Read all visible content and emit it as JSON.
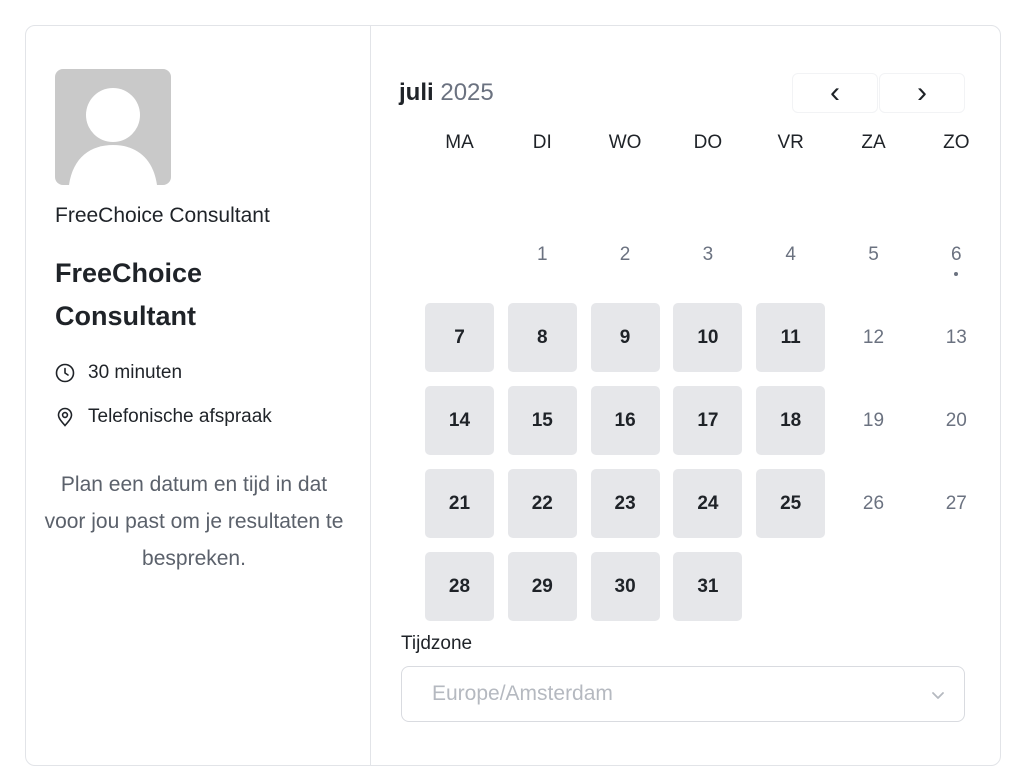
{
  "host": {
    "name": "FreeChoice Consultant",
    "avatar_icon": "user-silhouette-icon"
  },
  "event": {
    "title": "FreeChoice Consultant",
    "duration": "30 minuten",
    "duration_icon": "clock-icon",
    "location": "Telefonische afspraak",
    "location_icon": "location-pin-icon",
    "description": "Plan een datum en tijd in dat voor jou past om je resultaten te bespreken."
  },
  "calendar": {
    "month": "juli",
    "year": "2025",
    "prev_label": "‹",
    "next_label": "›",
    "weekdays": [
      "MA",
      "DI",
      "WO",
      "DO",
      "VR",
      "ZA",
      "ZO"
    ],
    "first_weekday_index": 1,
    "days": [
      {
        "day": "1",
        "available": false
      },
      {
        "day": "2",
        "available": false
      },
      {
        "day": "3",
        "available": false
      },
      {
        "day": "4",
        "available": false
      },
      {
        "day": "5",
        "available": false
      },
      {
        "day": "6",
        "available": false,
        "today": true
      },
      {
        "day": "7",
        "available": true
      },
      {
        "day": "8",
        "available": true
      },
      {
        "day": "9",
        "available": true
      },
      {
        "day": "10",
        "available": true
      },
      {
        "day": "11",
        "available": true
      },
      {
        "day": "12",
        "available": false
      },
      {
        "day": "13",
        "available": false
      },
      {
        "day": "14",
        "available": true
      },
      {
        "day": "15",
        "available": true
      },
      {
        "day": "16",
        "available": true
      },
      {
        "day": "17",
        "available": true
      },
      {
        "day": "18",
        "available": true
      },
      {
        "day": "19",
        "available": false
      },
      {
        "day": "20",
        "available": false
      },
      {
        "day": "21",
        "available": true
      },
      {
        "day": "22",
        "available": true
      },
      {
        "day": "23",
        "available": true
      },
      {
        "day": "24",
        "available": true
      },
      {
        "day": "25",
        "available": true
      },
      {
        "day": "26",
        "available": false
      },
      {
        "day": "27",
        "available": false
      },
      {
        "day": "28",
        "available": true
      },
      {
        "day": "29",
        "available": true
      },
      {
        "day": "30",
        "available": true
      },
      {
        "day": "31",
        "available": true
      }
    ]
  },
  "timezone": {
    "label": "Tijdzone",
    "value": "Europe/Amsterdam",
    "chevron_icon": "chevron-down-icon"
  },
  "colors": {
    "available_day_bg": "#e6e7ea",
    "text": "#1f2328",
    "muted_text": "#6b7280",
    "border": "#e2e4e8"
  }
}
